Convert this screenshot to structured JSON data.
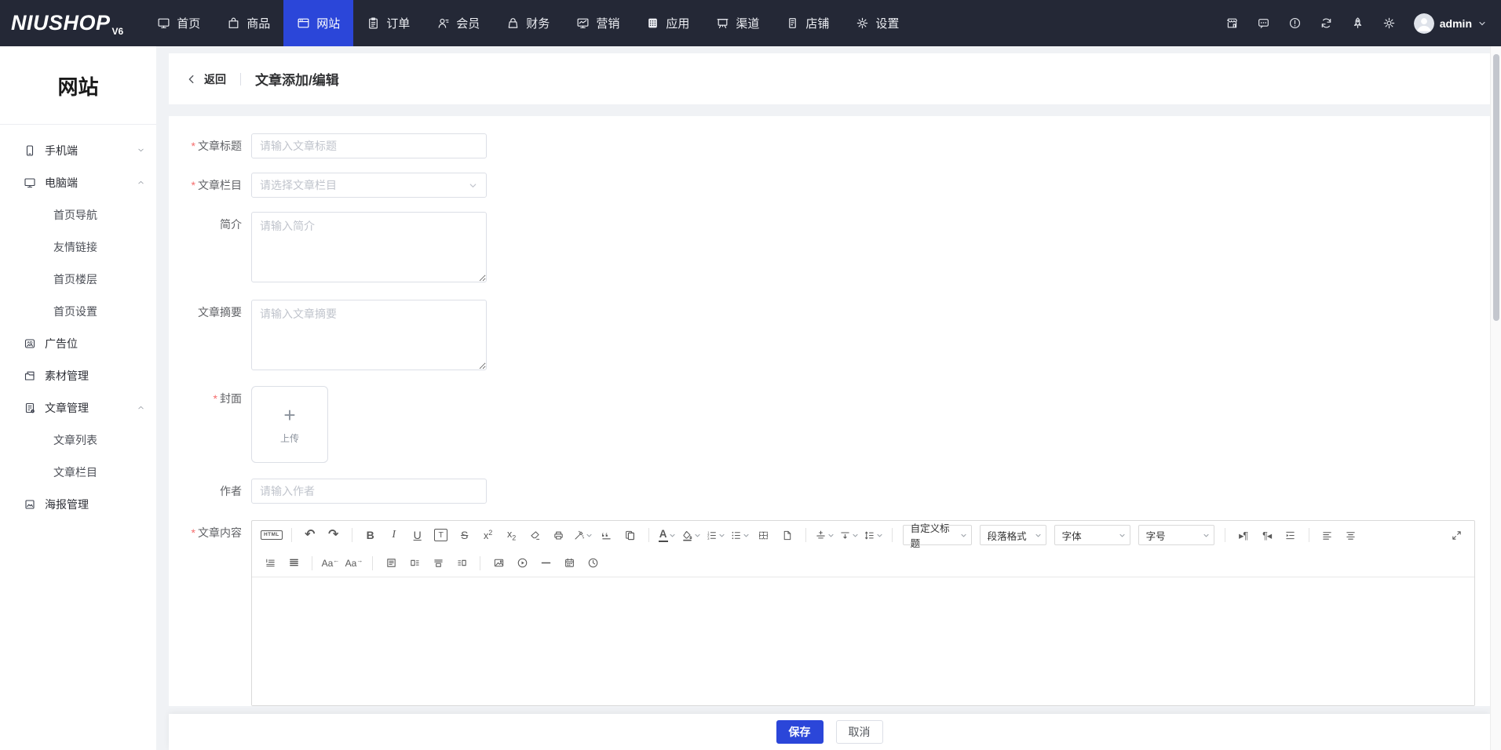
{
  "colors": {
    "accent": "#2B46D9",
    "navbar_bg": "#242836"
  },
  "navbar": {
    "logo": "NIUSHOP",
    "logo_badge": "V6",
    "items": [
      {
        "id": "home",
        "icon": "home",
        "label": "首页",
        "active": false
      },
      {
        "id": "goods",
        "icon": "goods",
        "label": "商品",
        "active": false
      },
      {
        "id": "website",
        "icon": "website",
        "label": "网站",
        "active": true
      },
      {
        "id": "order",
        "icon": "order",
        "label": "订单",
        "active": false
      },
      {
        "id": "member",
        "icon": "member",
        "label": "会员",
        "active": false
      },
      {
        "id": "finance",
        "icon": "finance",
        "label": "财务",
        "active": false
      },
      {
        "id": "marketing",
        "icon": "marketing",
        "label": "营销",
        "active": false
      },
      {
        "id": "apps",
        "icon": "apps",
        "label": "应用",
        "active": false
      },
      {
        "id": "channel",
        "icon": "channel",
        "label": "渠道",
        "active": false
      },
      {
        "id": "shop",
        "icon": "shop",
        "label": "店铺",
        "active": false
      },
      {
        "id": "settings",
        "icon": "settings",
        "label": "设置",
        "active": false
      }
    ],
    "right_icons": [
      {
        "id": "store",
        "icon": "store"
      },
      {
        "id": "message",
        "icon": "message"
      },
      {
        "id": "alert",
        "icon": "alert"
      },
      {
        "id": "sync",
        "icon": "sync"
      },
      {
        "id": "rocket",
        "icon": "rocket"
      },
      {
        "id": "gear",
        "icon": "gear"
      }
    ],
    "user": {
      "name": "admin"
    }
  },
  "sidebar": {
    "title": "网站",
    "items": [
      {
        "id": "mobile",
        "label": "手机端",
        "icon": "mobile",
        "level": 1,
        "chevron": "down"
      },
      {
        "id": "pc",
        "label": "电脑端",
        "icon": "desktop",
        "level": 1,
        "chevron": "up"
      },
      {
        "id": "home-nav",
        "label": "首页导航",
        "level": 2
      },
      {
        "id": "friend-links",
        "label": "友情链接",
        "level": 2
      },
      {
        "id": "home-floor",
        "label": "首页楼层",
        "level": 2
      },
      {
        "id": "home-setting",
        "label": "首页设置",
        "level": 2
      },
      {
        "id": "ad-position",
        "label": "广告位",
        "icon": "ad",
        "level": 1
      },
      {
        "id": "material",
        "label": "素材管理",
        "icon": "folder",
        "level": 1
      },
      {
        "id": "article-manage",
        "label": "文章管理",
        "icon": "article",
        "level": 1,
        "chevron": "up"
      },
      {
        "id": "article-list",
        "label": "文章列表",
        "level": 2
      },
      {
        "id": "article-category",
        "label": "文章栏目",
        "level": 2
      },
      {
        "id": "poster",
        "label": "海报管理",
        "icon": "poster",
        "level": 1
      }
    ]
  },
  "page_header": {
    "back_label": "返回",
    "title": "文章添加/编辑"
  },
  "form": {
    "title": {
      "label": "文章标题",
      "required": true,
      "placeholder": "请输入文章标题",
      "value": ""
    },
    "category": {
      "label": "文章栏目",
      "required": true,
      "placeholder": "请选择文章栏目"
    },
    "intro": {
      "label": "简介",
      "required": false,
      "placeholder": "请输入简介",
      "value": ""
    },
    "summary": {
      "label": "文章摘要",
      "required": false,
      "placeholder": "请输入文章摘要",
      "value": ""
    },
    "cover": {
      "label": "封面",
      "required": true,
      "upload_label": "上传"
    },
    "author": {
      "label": "作者",
      "required": false,
      "placeholder": "请输入作者",
      "value": ""
    },
    "content": {
      "label": "文章内容",
      "required": true
    }
  },
  "editor": {
    "toolbar_row1": [
      {
        "kind": "icon",
        "name": "html-source"
      },
      {
        "kind": "divider"
      },
      {
        "kind": "icon",
        "name": "undo"
      },
      {
        "kind": "icon",
        "name": "redo"
      },
      {
        "kind": "divider"
      },
      {
        "kind": "icon",
        "name": "bold"
      },
      {
        "kind": "icon",
        "name": "italic"
      },
      {
        "kind": "icon",
        "name": "underline"
      },
      {
        "kind": "icon",
        "name": "format-title"
      },
      {
        "kind": "icon",
        "name": "strikethrough"
      },
      {
        "kind": "icon",
        "name": "superscript"
      },
      {
        "kind": "icon",
        "name": "subscript"
      },
      {
        "kind": "icon",
        "name": "clear-format"
      },
      {
        "kind": "icon",
        "name": "print"
      },
      {
        "kind": "icon",
        "name": "format-brush",
        "caret": true
      },
      {
        "kind": "icon",
        "name": "blockquote"
      },
      {
        "kind": "icon",
        "name": "paste"
      },
      {
        "kind": "divider"
      },
      {
        "kind": "icon",
        "name": "font-color",
        "caret": true
      },
      {
        "kind": "icon",
        "name": "background-color",
        "caret": true
      },
      {
        "kind": "icon",
        "name": "ordered-list",
        "caret": true
      },
      {
        "kind": "icon",
        "name": "unordered-list",
        "caret": true
      },
      {
        "kind": "icon",
        "name": "table"
      },
      {
        "kind": "icon",
        "name": "new-page"
      },
      {
        "kind": "divider"
      },
      {
        "kind": "icon",
        "name": "insert-line-above",
        "caret": true
      },
      {
        "kind": "icon",
        "name": "insert-line-below",
        "caret": true
      },
      {
        "kind": "icon",
        "name": "line-height",
        "caret": true
      },
      {
        "kind": "divider"
      },
      {
        "kind": "select",
        "name": "custom-heading",
        "label": "自定义标题"
      },
      {
        "kind": "select",
        "name": "paragraph-format",
        "label": "段落格式"
      },
      {
        "kind": "select",
        "name": "font-family",
        "label": "字体"
      },
      {
        "kind": "select",
        "name": "font-size",
        "label": "字号"
      },
      {
        "kind": "divider"
      },
      {
        "kind": "icon",
        "name": "paragraph-ltr"
      },
      {
        "kind": "icon",
        "name": "paragraph-rtl"
      },
      {
        "kind": "icon",
        "name": "indent"
      },
      {
        "kind": "divider"
      },
      {
        "kind": "icon",
        "name": "align-left"
      },
      {
        "kind": "icon",
        "name": "align-center"
      },
      {
        "kind": "spacer"
      },
      {
        "kind": "icon",
        "name": "fullscreen"
      }
    ],
    "toolbar_row2": [
      {
        "kind": "icon",
        "name": "indent-paragraph"
      },
      {
        "kind": "icon",
        "name": "justify"
      },
      {
        "kind": "divider"
      },
      {
        "kind": "icon",
        "name": "letter-spacing-decrease"
      },
      {
        "kind": "icon",
        "name": "letter-spacing-increase"
      },
      {
        "kind": "divider"
      },
      {
        "kind": "icon",
        "name": "insert-template"
      },
      {
        "kind": "icon",
        "name": "text-wrap-left"
      },
      {
        "kind": "icon",
        "name": "text-wrap-bottom"
      },
      {
        "kind": "icon",
        "name": "text-wrap-right"
      },
      {
        "kind": "divider"
      },
      {
        "kind": "icon",
        "name": "insert-image"
      },
      {
        "kind": "icon",
        "name": "insert-video"
      },
      {
        "kind": "icon",
        "name": "horizontal-rule"
      },
      {
        "kind": "icon",
        "name": "insert-date"
      },
      {
        "kind": "icon",
        "name": "insert-time"
      }
    ]
  },
  "footer": {
    "save_label": "保存",
    "cancel_label": "取消"
  }
}
